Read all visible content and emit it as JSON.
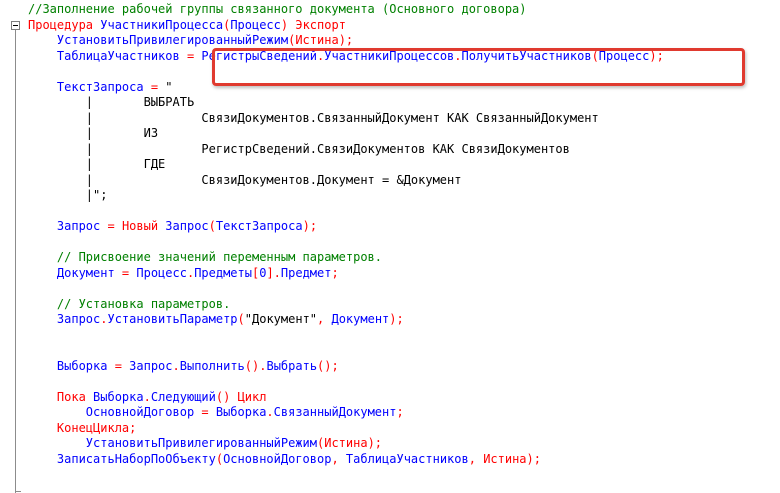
{
  "editor": {
    "lines": [
      [
        {
          "t": "//Заполнение рабочей группы связанного документа (Основного договора)",
          "c": "comment"
        }
      ],
      [
        {
          "t": "Процедура ",
          "c": "keyword"
        },
        {
          "t": "УчастникиПроцесса",
          "c": "text"
        },
        {
          "t": "(",
          "c": "op"
        },
        {
          "t": "Процесс",
          "c": "text"
        },
        {
          "t": ") ",
          "c": "op"
        },
        {
          "t": "Экспорт",
          "c": "keyword"
        }
      ],
      [
        {
          "t": "    УстановитьПривилегированныйРежим",
          "c": "text"
        },
        {
          "t": "(",
          "c": "op"
        },
        {
          "t": "Истина",
          "c": "keyword"
        },
        {
          "t": ");",
          "c": "op"
        }
      ],
      [
        {
          "t": "    ТаблицаУчастников ",
          "c": "text"
        },
        {
          "t": "= ",
          "c": "op"
        },
        {
          "t": "РегистрыСведений",
          "c": "text"
        },
        {
          "t": ".",
          "c": "op"
        },
        {
          "t": "УчастникиПроцессов",
          "c": "text"
        },
        {
          "t": ".",
          "c": "op"
        },
        {
          "t": "ПолучитьУчастников",
          "c": "text"
        },
        {
          "t": "(",
          "c": "op"
        },
        {
          "t": "Процесс",
          "c": "text"
        },
        {
          "t": ");",
          "c": "op"
        }
      ],
      [
        {
          "t": "",
          "c": "text"
        }
      ],
      [
        {
          "t": "    ТекстЗапроса ",
          "c": "text"
        },
        {
          "t": "= ",
          "c": "op"
        },
        {
          "t": "\"",
          "c": "str"
        }
      ],
      [
        {
          "t": "        |       ВЫБРАТЬ",
          "c": "str"
        }
      ],
      [
        {
          "t": "        |               СвязиДокументов.СвязанныйДокумент КАК СвязанныйДокумент",
          "c": "str"
        }
      ],
      [
        {
          "t": "        |       ИЗ",
          "c": "str"
        }
      ],
      [
        {
          "t": "        |               РегистрСведений.СвязиДокументов КАК СвязиДокументов",
          "c": "str"
        }
      ],
      [
        {
          "t": "        |       ГДЕ",
          "c": "str"
        }
      ],
      [
        {
          "t": "        |               СвязиДокументов.Документ = &Документ",
          "c": "str"
        }
      ],
      [
        {
          "t": "        |\";",
          "c": "str"
        }
      ],
      [
        {
          "t": "",
          "c": "text"
        }
      ],
      [
        {
          "t": "    Запрос ",
          "c": "text"
        },
        {
          "t": "= ",
          "c": "op"
        },
        {
          "t": "Новый ",
          "c": "keyword"
        },
        {
          "t": "Запрос",
          "c": "text"
        },
        {
          "t": "(",
          "c": "op"
        },
        {
          "t": "ТекстЗапроса",
          "c": "text"
        },
        {
          "t": ");",
          "c": "op"
        }
      ],
      [
        {
          "t": "",
          "c": "text"
        }
      ],
      [
        {
          "t": "    // Присвоение значений переменным параметров.",
          "c": "comment"
        }
      ],
      [
        {
          "t": "    Документ ",
          "c": "text"
        },
        {
          "t": "= ",
          "c": "op"
        },
        {
          "t": "Процесс",
          "c": "text"
        },
        {
          "t": ".",
          "c": "op"
        },
        {
          "t": "Предметы",
          "c": "text"
        },
        {
          "t": "[",
          "c": "op"
        },
        {
          "t": "0",
          "c": "text"
        },
        {
          "t": "].",
          "c": "op"
        },
        {
          "t": "Предмет",
          "c": "text"
        },
        {
          "t": ";",
          "c": "op"
        }
      ],
      [
        {
          "t": "",
          "c": "text"
        }
      ],
      [
        {
          "t": "    // Установка параметров.",
          "c": "comment"
        }
      ],
      [
        {
          "t": "    Запрос",
          "c": "text"
        },
        {
          "t": ".",
          "c": "op"
        },
        {
          "t": "УстановитьПараметр",
          "c": "text"
        },
        {
          "t": "(",
          "c": "op"
        },
        {
          "t": "\"Документ\"",
          "c": "str"
        },
        {
          "t": ", ",
          "c": "op"
        },
        {
          "t": "Документ",
          "c": "text"
        },
        {
          "t": ");",
          "c": "op"
        }
      ],
      [
        {
          "t": "",
          "c": "text"
        }
      ],
      [
        {
          "t": "",
          "c": "text"
        }
      ],
      [
        {
          "t": "    Выборка ",
          "c": "text"
        },
        {
          "t": "= ",
          "c": "op"
        },
        {
          "t": "Запрос",
          "c": "text"
        },
        {
          "t": ".",
          "c": "op"
        },
        {
          "t": "Выполнить",
          "c": "text"
        },
        {
          "t": "().",
          "c": "op"
        },
        {
          "t": "Выбрать",
          "c": "text"
        },
        {
          "t": "();",
          "c": "op"
        }
      ],
      [
        {
          "t": "",
          "c": "text"
        }
      ],
      [
        {
          "t": "    Пока ",
          "c": "keyword"
        },
        {
          "t": "Выборка",
          "c": "text"
        },
        {
          "t": ".",
          "c": "op"
        },
        {
          "t": "Следующий",
          "c": "text"
        },
        {
          "t": "() ",
          "c": "op"
        },
        {
          "t": "Цикл",
          "c": "keyword"
        }
      ],
      [
        {
          "t": "        ОсновнойДоговор ",
          "c": "text"
        },
        {
          "t": "= ",
          "c": "op"
        },
        {
          "t": "Выборка",
          "c": "text"
        },
        {
          "t": ".",
          "c": "op"
        },
        {
          "t": "СвязанныйДокумент",
          "c": "text"
        },
        {
          "t": ";",
          "c": "op"
        }
      ],
      [
        {
          "t": "    КонецЦикла",
          "c": "keyword"
        },
        {
          "t": ";",
          "c": "op"
        }
      ],
      [
        {
          "t": "        УстановитьПривилегированныйРежим",
          "c": "text"
        },
        {
          "t": "(",
          "c": "op"
        },
        {
          "t": "Истина",
          "c": "keyword"
        },
        {
          "t": ");",
          "c": "op"
        }
      ],
      [
        {
          "t": "    ЗаписатьНаборПоОбъекту",
          "c": "text"
        },
        {
          "t": "(",
          "c": "op"
        },
        {
          "t": "ОсновнойДоговор",
          "c": "text"
        },
        {
          "t": ", ",
          "c": "op"
        },
        {
          "t": "ТаблицаУчастников",
          "c": "text"
        },
        {
          "t": ", ",
          "c": "op"
        },
        {
          "t": "Истина",
          "c": "keyword"
        },
        {
          "t": ");",
          "c": "op"
        }
      ]
    ]
  },
  "colors": {
    "comment": "#008000",
    "keyword": "#ff0000",
    "identifier": "#0000ff",
    "highlight_border": "#e03a2f"
  },
  "highlight": {
    "target_line": 3,
    "text": "РегистрыСведений.УчастникиПроцессов.ПолучитьУчастников(Процесс);"
  },
  "fold": {
    "icon": "collapse-minus-icon"
  }
}
